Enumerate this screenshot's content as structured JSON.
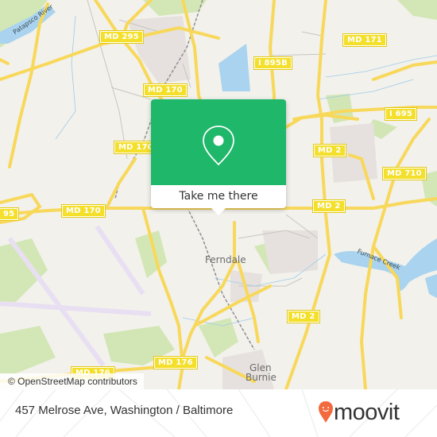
{
  "map": {
    "road_shields": [
      {
        "label": "MD 295"
      },
      {
        "label": "MD 171"
      },
      {
        "label": "I 895B"
      },
      {
        "label": "MD 170"
      },
      {
        "label": "I 695"
      },
      {
        "label": "MD 170"
      },
      {
        "label": "MD 2"
      },
      {
        "label": "MD 710"
      },
      {
        "label": "MD 170"
      },
      {
        "label": "MD 2"
      },
      {
        "label": "95"
      },
      {
        "label": "MD 2"
      },
      {
        "label": "MD 176"
      },
      {
        "label": "MD 176"
      }
    ],
    "places": {
      "ferndale": "Ferndale",
      "glen_burnie_1": "Glen",
      "glen_burnie_2": "Burnie"
    },
    "water_labels": {
      "patapsco": "Patapsco River",
      "furnace_creek": "Furnace Creek"
    },
    "attribution": "© OpenStreetMap contributors"
  },
  "popup": {
    "icon": "map-pin-icon",
    "button_label": "Take me there",
    "accent_color": "#1fb76a"
  },
  "footer": {
    "address": "457 Melrose Ave, Washington / Baltimore",
    "logo_text": "moovit",
    "logo_color": "#f26a3d"
  }
}
